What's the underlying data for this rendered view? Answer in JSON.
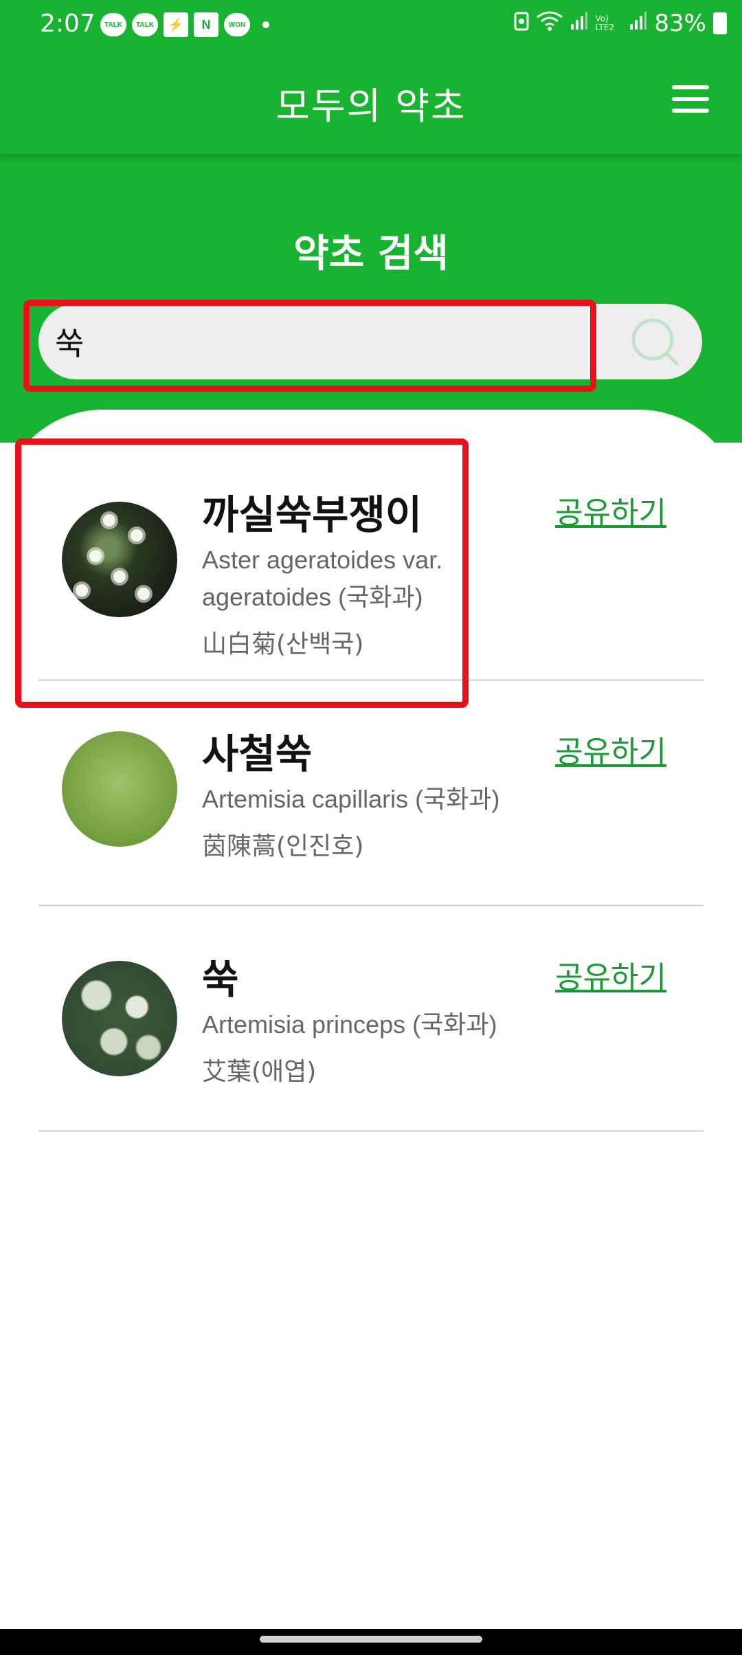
{
  "status_bar": {
    "time": "2:07",
    "notifications": [
      {
        "icon": "kakaotalk-icon",
        "text": "TALK"
      },
      {
        "icon": "kakaotalk-icon",
        "text": "TALK"
      },
      {
        "icon": "app-icon",
        "text": "⚡"
      },
      {
        "icon": "naver-icon",
        "text": "N"
      },
      {
        "icon": "won-icon",
        "text": "WON"
      }
    ],
    "network_label": "Vo) LTE2",
    "battery": "83%"
  },
  "header": {
    "title": "모두의 약초"
  },
  "search": {
    "heading": "약초 검색",
    "query": "쑥"
  },
  "results": [
    {
      "name": "까실쑥부쟁이",
      "scientific_line1": "Aster ageratoides var.",
      "scientific_line2": "ageratoides (국화과)",
      "herbal": "山白菊(산백국)",
      "share": "공유하기"
    },
    {
      "name": "사철쑥",
      "scientific_line1": "Artemisia capillaris (국화과)",
      "herbal": "茵陳蒿(인진호)",
      "share": "공유하기"
    },
    {
      "name": "쑥",
      "scientific_line1": "Artemisia princeps (국화과)",
      "herbal": "艾葉(애엽)",
      "share": "공유하기"
    }
  ],
  "colors": {
    "brand_green": "#18b431",
    "link_green": "#1a9a32",
    "highlight_red": "#e8101a"
  }
}
